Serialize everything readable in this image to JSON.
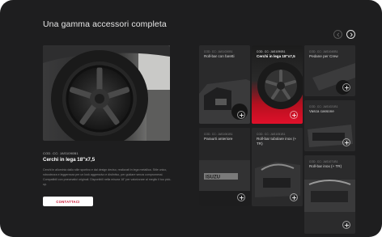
{
  "section": {
    "title": "Una gamma accessori completa"
  },
  "nav": {
    "prev_icon": "chevron-left-icon",
    "next_icon": "chevron-right-icon"
  },
  "product": {
    "code": "COD. CC: JAS1090B1",
    "title": "Cerchi in lega 18\"x7,5",
    "description": "Cerchi in alluminio dallo stile sportivo e dal design deciso, realizzati in lega metallica. Stile unico, robustezza e leggerezza per un look aggressivo e distintivo, per guidare senza compromessi. Compatibili con pneumatici originali. Disponibili nella misura 18\" per valorizzare al meglio il tuo pick-up.",
    "cta_label": "CONTATTACI"
  },
  "tiles": [
    {
      "code": "COD. CC: JAS1030B1",
      "title": "Roll-bar con faretti",
      "active": false
    },
    {
      "code": "COD. CC: JAS1090B1",
      "title": "Cerchi in lega 18\"x7,5",
      "active": true
    },
    {
      "code": "COD. CC: JAS1040B1",
      "title": "Pedane per Crew",
      "active": false
    },
    {
      "code": "COD. CC: JAS1021B1",
      "title": "Vasca cassone",
      "active": false
    },
    {
      "code": "COD. CC: JAS1061B1",
      "title": "Paraurti anteriore",
      "active": false
    },
    {
      "code": "COD. CC: JAS1051B1",
      "title": "Roll-bar tubolare inox (+ TR)",
      "active": false
    },
    {
      "code": "COD. CC: JAS1071B1",
      "title": "Roll-bar inox (+ TR)",
      "active": false
    }
  ],
  "colors": {
    "background": "#1e1e1f",
    "accent": "#c8102e",
    "cta_text": "#c8102e"
  }
}
